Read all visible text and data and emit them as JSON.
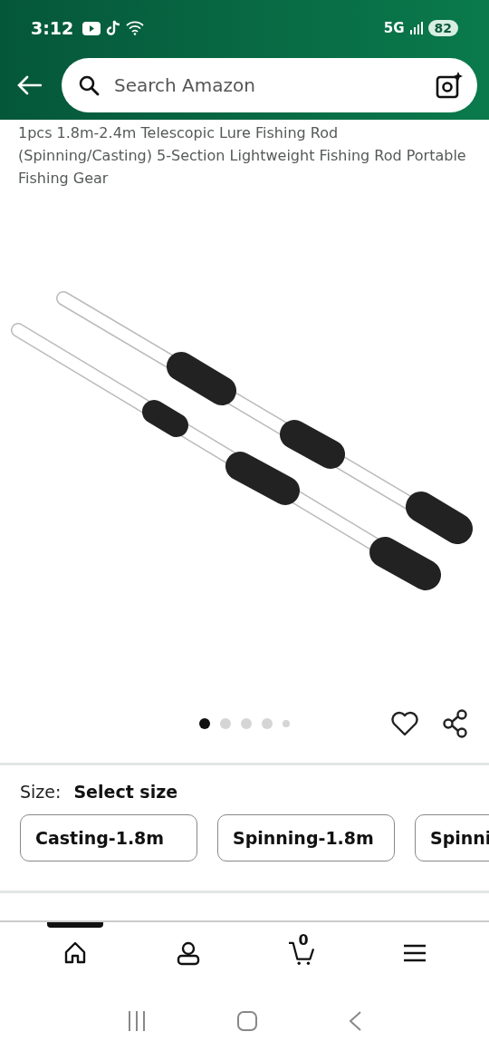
{
  "status_bar": {
    "time": "3:12",
    "network": "5G",
    "battery": "82"
  },
  "search": {
    "placeholder": "Search Amazon"
  },
  "product": {
    "title": "1pcs 1.8m-2.4m Telescopic Lure Fishing Rod (Spinning/Casting) 5-Section Lightweight Fishing Rod Portable Fishing Gear"
  },
  "gallery": {
    "dots": [
      {
        "selected": true
      },
      {
        "selected": false
      },
      {
        "selected": false
      },
      {
        "selected": false
      },
      {
        "selected": false
      }
    ]
  },
  "size": {
    "label": "Size:",
    "value": "Select size",
    "options": [
      {
        "label": "Casting-1.8m",
        "selected": false
      },
      {
        "label": "Spinning-1.8m",
        "selected": false
      },
      {
        "label": "Spinni",
        "selected": false
      }
    ]
  },
  "bottom_nav": [
    {
      "kind": "home",
      "selected": true
    },
    {
      "kind": "account",
      "selected": false
    },
    {
      "kind": "cart",
      "count": "0",
      "selected": false
    },
    {
      "kind": "menu",
      "selected": false
    }
  ]
}
